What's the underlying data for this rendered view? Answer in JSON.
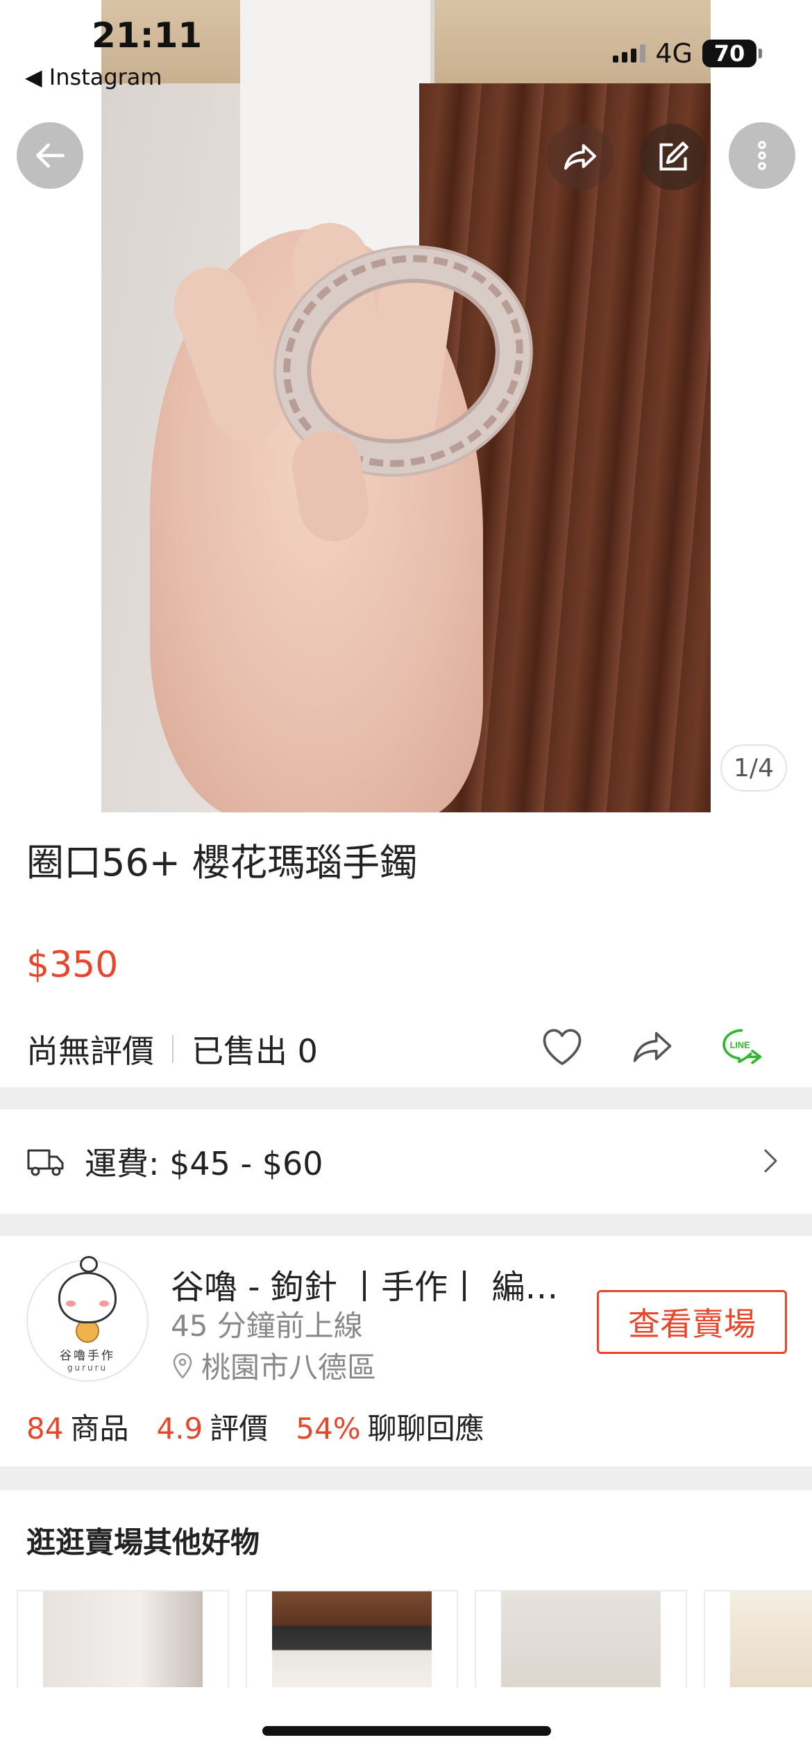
{
  "status_bar": {
    "time": "21:11",
    "back_app": "◀ Instagram",
    "network": "4G",
    "battery": "70"
  },
  "gallery": {
    "pager": "1/4"
  },
  "product": {
    "title": "圈口56+ 櫻花瑪瑙手鐲",
    "price": "$350",
    "rating": "尚無評價",
    "sold": "已售出 0"
  },
  "shipping": {
    "label": "運費: $45 - $60"
  },
  "shop": {
    "name": "谷嚕 - 鉤針 丨手作丨 編織 小物",
    "online": "45 分鐘前上線",
    "location": "桃園市八德區",
    "visit_button": "查看賣場",
    "avatar_text1": "谷嚕手作",
    "avatar_text2": "gururu",
    "stats": [
      {
        "num": "84",
        "label": "商品"
      },
      {
        "num": "4.9",
        "label": "評價"
      },
      {
        "num": "54%",
        "label": "聊聊回應"
      }
    ]
  },
  "more_section": {
    "title": "逛逛賣場其他好物"
  },
  "colors": {
    "accent": "#e8462b",
    "line_green": "#2fb82f",
    "divider": "#eeeeee"
  },
  "icons": [
    "back-arrow-icon",
    "share-icon",
    "edit-icon",
    "more-icon",
    "heart-icon",
    "line-icon",
    "truck-icon",
    "chevron-right-icon",
    "location-pin-icon"
  ]
}
